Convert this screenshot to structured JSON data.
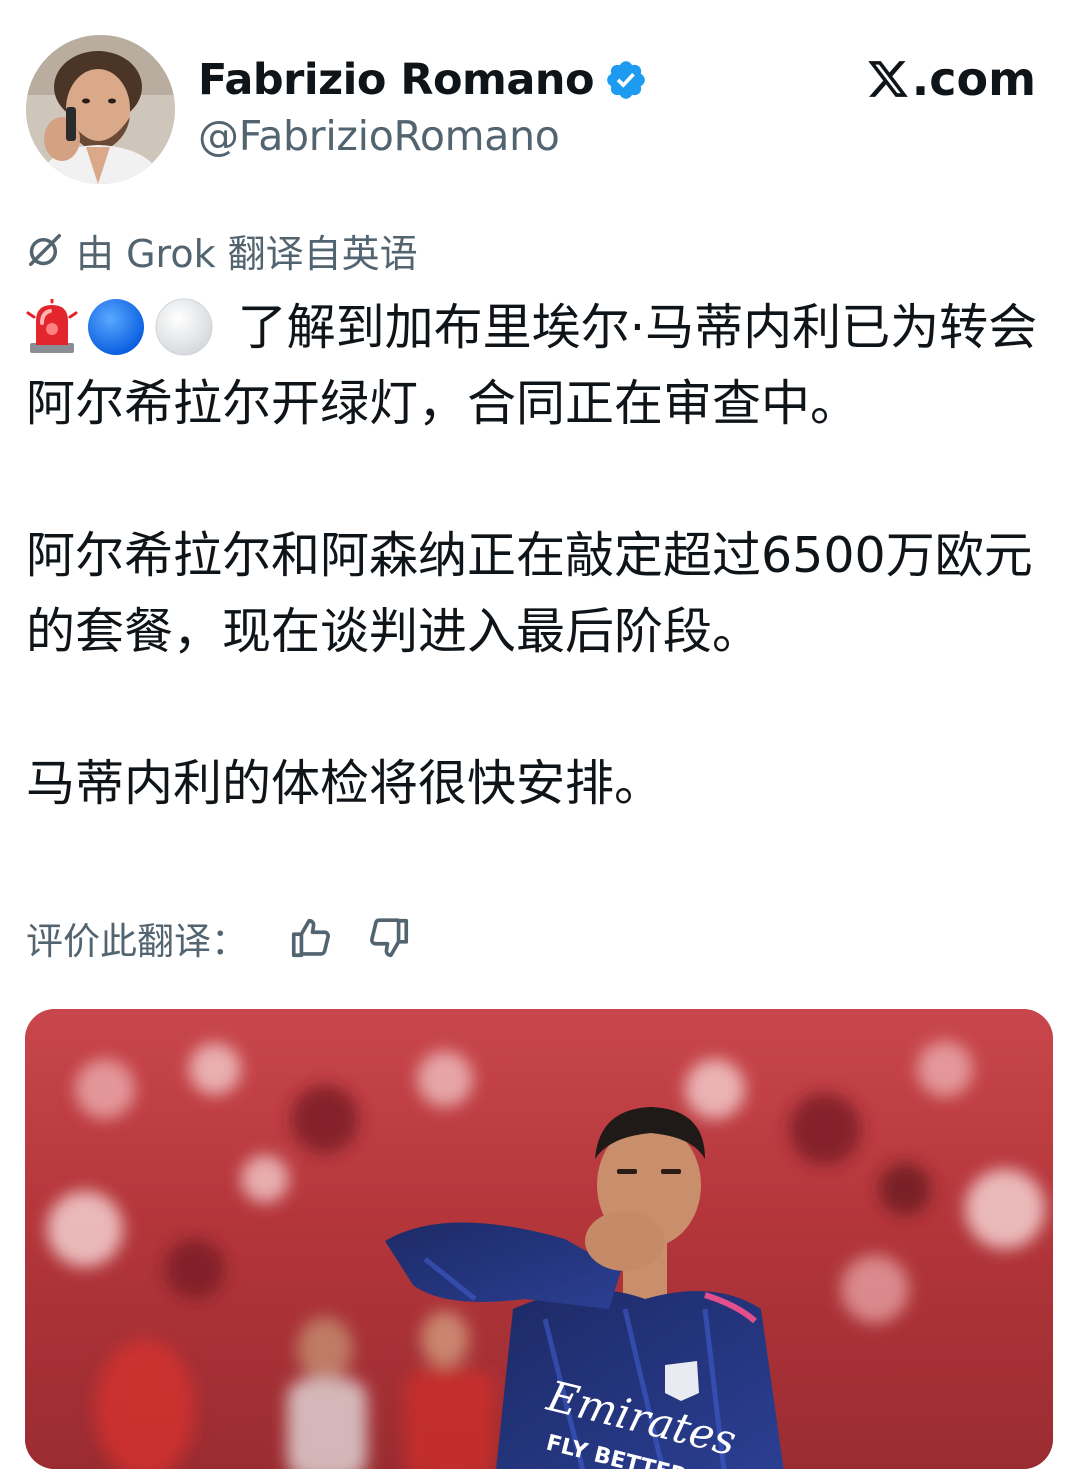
{
  "header": {
    "display_name": "Fabrizio Romano",
    "handle": "@FabrizioRomano",
    "brand": ".com",
    "verified": true,
    "verified_color": "#1d9bf0"
  },
  "translation": {
    "note": "由 Grok 翻译自英语",
    "rate_label": "评价此翻译："
  },
  "tweet": {
    "emojis": [
      "siren-icon",
      "blue-circle-icon",
      "white-circle-icon"
    ],
    "line1": "了解到加布里埃尔·马蒂内利已为转会阿尔希拉尔开绿灯，合同正在审查中。",
    "paragraph2": "阿尔希拉尔和阿森纳正在敲定超过6500万欧元的套餐，现在谈判进入最后阶段。",
    "paragraph3": "马蒂内利的体检将很快安排。"
  },
  "media": {
    "shirt_sponsor": "Emirates",
    "shirt_tagline": "FLY BETTER"
  },
  "colors": {
    "text_primary": "#0f1419",
    "text_secondary": "#536471",
    "accent": "#1d9bf0"
  }
}
